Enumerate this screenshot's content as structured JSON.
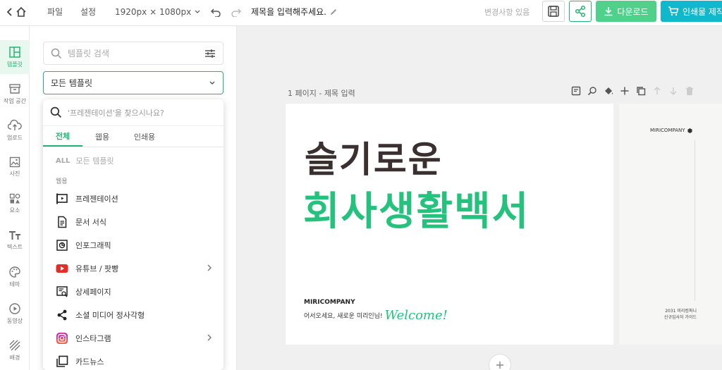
{
  "topbar": {
    "menu_file": "파일",
    "menu_settings": "설정",
    "dimensions": "1920px × 1080px",
    "doc_title": "제목을 입력해주세요.",
    "changes_status": "변경사항 있음",
    "download_label": "다운로드",
    "print_label": "인쇄물 제작"
  },
  "rail": {
    "items": [
      {
        "label": "템플릿",
        "icon": "layout-icon"
      },
      {
        "label": "작업 공간",
        "icon": "archive-icon"
      },
      {
        "label": "업로드",
        "icon": "upload-cloud-icon"
      },
      {
        "label": "사진",
        "icon": "image-icon"
      },
      {
        "label": "요소",
        "icon": "shapes-icon"
      },
      {
        "label": "텍스트",
        "icon": "text-icon"
      },
      {
        "label": "테마",
        "icon": "palette-icon"
      },
      {
        "label": "동영상",
        "icon": "play-icon"
      },
      {
        "label": "배경",
        "icon": "pattern-icon"
      }
    ]
  },
  "panel": {
    "search_placeholder": "템플릿 검색",
    "select_value": "모든 템플릿"
  },
  "dropdown": {
    "search_placeholder": "'프레젠테이션'을 찾으시나요?",
    "tabs": [
      "전체",
      "웹용",
      "인쇄용"
    ],
    "all_badge": "ALL",
    "all_label": "모든 템플릿",
    "section_web": "웹용",
    "items": [
      {
        "label": "프레젠테이션",
        "icon": "presentation-icon",
        "has_submenu": false
      },
      {
        "label": "문서 서식",
        "icon": "document-icon",
        "has_submenu": false
      },
      {
        "label": "인포그래픽",
        "icon": "infographic-icon",
        "has_submenu": false
      },
      {
        "label": "유튜브 / 팟빵",
        "icon": "youtube-icon",
        "has_submenu": true
      },
      {
        "label": "상세페이지",
        "icon": "detail-page-icon",
        "has_submenu": false
      },
      {
        "label": "소셜 미디어 정사각형",
        "icon": "share-icon",
        "has_submenu": false
      },
      {
        "label": "인스타그램",
        "icon": "instagram-icon",
        "has_submenu": true
      },
      {
        "label": "카드뉴스",
        "icon": "card-news-icon",
        "has_submenu": false
      }
    ]
  },
  "canvas": {
    "page_label": "1 페이지 - 제목 입력",
    "headline_line1": "슬기로운",
    "headline_line2": "회사생활백서",
    "company": "MIRICOMPANY",
    "welcome_text": "어서오세요, 새로운 미리인님!",
    "welcome_script": "Welcome!",
    "page2_company": "MIRICOMPANY",
    "page2_footer_line1": "2031 미리컴퍼니",
    "page2_footer_line2": "신규입사자 가이드"
  },
  "colors": {
    "accent": "#22b573",
    "headline_green": "#25c27e",
    "headline_dark": "#3a3030",
    "download_bg": "#4fd18b",
    "print_bg": "#11b8cc"
  }
}
